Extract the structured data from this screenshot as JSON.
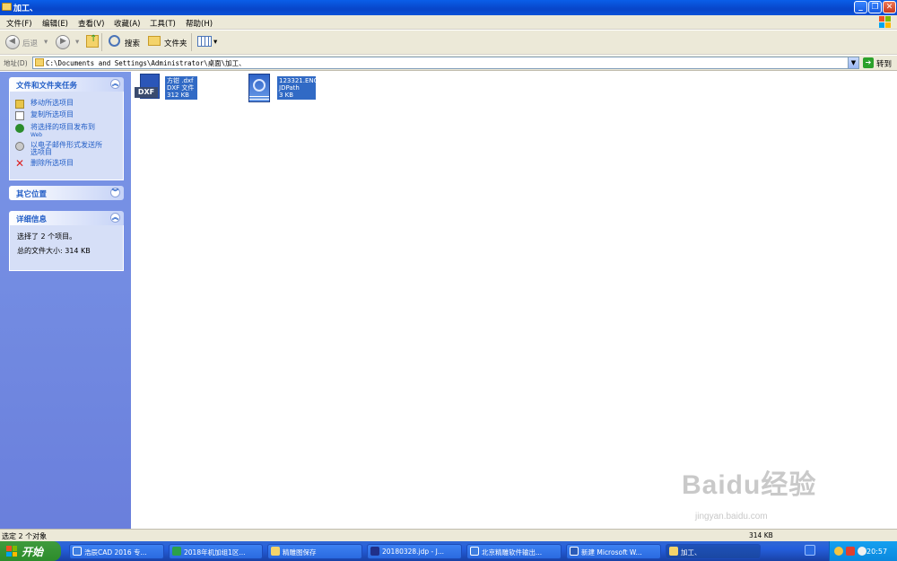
{
  "window": {
    "title": "加工、"
  },
  "menu": [
    "文件(F)",
    "编辑(E)",
    "查看(V)",
    "收藏(A)",
    "工具(T)",
    "帮助(H)"
  ],
  "toolbar": {
    "back": "后退",
    "search": "搜索",
    "folders": "文件夹"
  },
  "address": {
    "label": "地址(D)",
    "path": "C:\\Documents and Settings\\Administrator\\桌面\\加工、",
    "go": "转到"
  },
  "sidebar": {
    "file_tasks": {
      "title": "文件和文件夹任务",
      "items": [
        "移动所选项目",
        "复制所选项目",
        "将选择的项目发布到",
        "Web",
        "以电子邮件形式发送所",
        "选项目",
        "删除所选项目"
      ]
    },
    "other_places": {
      "title": "其它位置"
    },
    "details": {
      "title": "详细信息",
      "selected": "选择了 2 个项目。",
      "total_size": "总的文件大小: 314 KB"
    }
  },
  "files": [
    {
      "name": "方钳 .dxf",
      "type": "DXF 文件",
      "size": "312 KB",
      "icon_label": "DXF"
    },
    {
      "name": "123321.ENG",
      "type": "JDPath",
      "size": "3 KB"
    }
  ],
  "status": {
    "left": "选定 2 个对象",
    "size": "314 KB"
  },
  "taskbar": {
    "start": "开始",
    "items": [
      "浩辰CAD 2016 专...",
      "2018年机加组1区...",
      "精雕图保存",
      "20180328.jdp - J...",
      "北京精雕软件输出...",
      "新建 Microsoft W...",
      "加工、"
    ],
    "clock": "20:57"
  },
  "watermark": {
    "brand": "Baidu经验",
    "url": "jingyan.baidu.com"
  },
  "colors": {
    "title_bar": "#0a5ee8",
    "sidebar": "#7b97e7",
    "selection": "#316ac5",
    "start": "#3f9b3d"
  }
}
